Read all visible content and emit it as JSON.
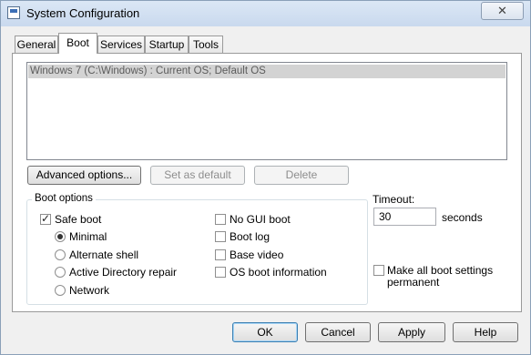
{
  "window": {
    "title": "System Configuration",
    "close_icon": "close-icon",
    "close_glyph": "✕"
  },
  "tabs": [
    {
      "label": "General",
      "active": false
    },
    {
      "label": "Boot",
      "active": true
    },
    {
      "label": "Services",
      "active": false
    },
    {
      "label": "Startup",
      "active": false
    },
    {
      "label": "Tools",
      "active": false
    }
  ],
  "os_list": {
    "items": [
      "Windows 7 (C:\\Windows) : Current OS; Default OS"
    ],
    "selected": 0
  },
  "list_buttons": {
    "advanced": "Advanced options...",
    "set_default": "Set as default",
    "delete": "Delete"
  },
  "boot_options": {
    "label": "Boot options",
    "safe_boot": {
      "label": "Safe boot",
      "checked": true
    },
    "safe_modes": [
      {
        "label": "Minimal",
        "selected": true
      },
      {
        "label": "Alternate shell",
        "selected": false
      },
      {
        "label": "Active Directory repair",
        "selected": false
      },
      {
        "label": "Network",
        "selected": false
      }
    ],
    "flags": [
      {
        "label": "No GUI boot",
        "checked": false
      },
      {
        "label": "Boot log",
        "checked": false
      },
      {
        "label": "Base video",
        "checked": false
      },
      {
        "label": "OS boot information",
        "checked": false
      }
    ]
  },
  "timeout": {
    "label": "Timeout:",
    "value": "30",
    "unit": "seconds"
  },
  "permanent": {
    "label_line1": "Make all boot settings",
    "label_line2": "permanent",
    "checked": false
  },
  "dialog_buttons": {
    "ok": "OK",
    "cancel": "Cancel",
    "apply": "Apply",
    "help": "Help"
  }
}
